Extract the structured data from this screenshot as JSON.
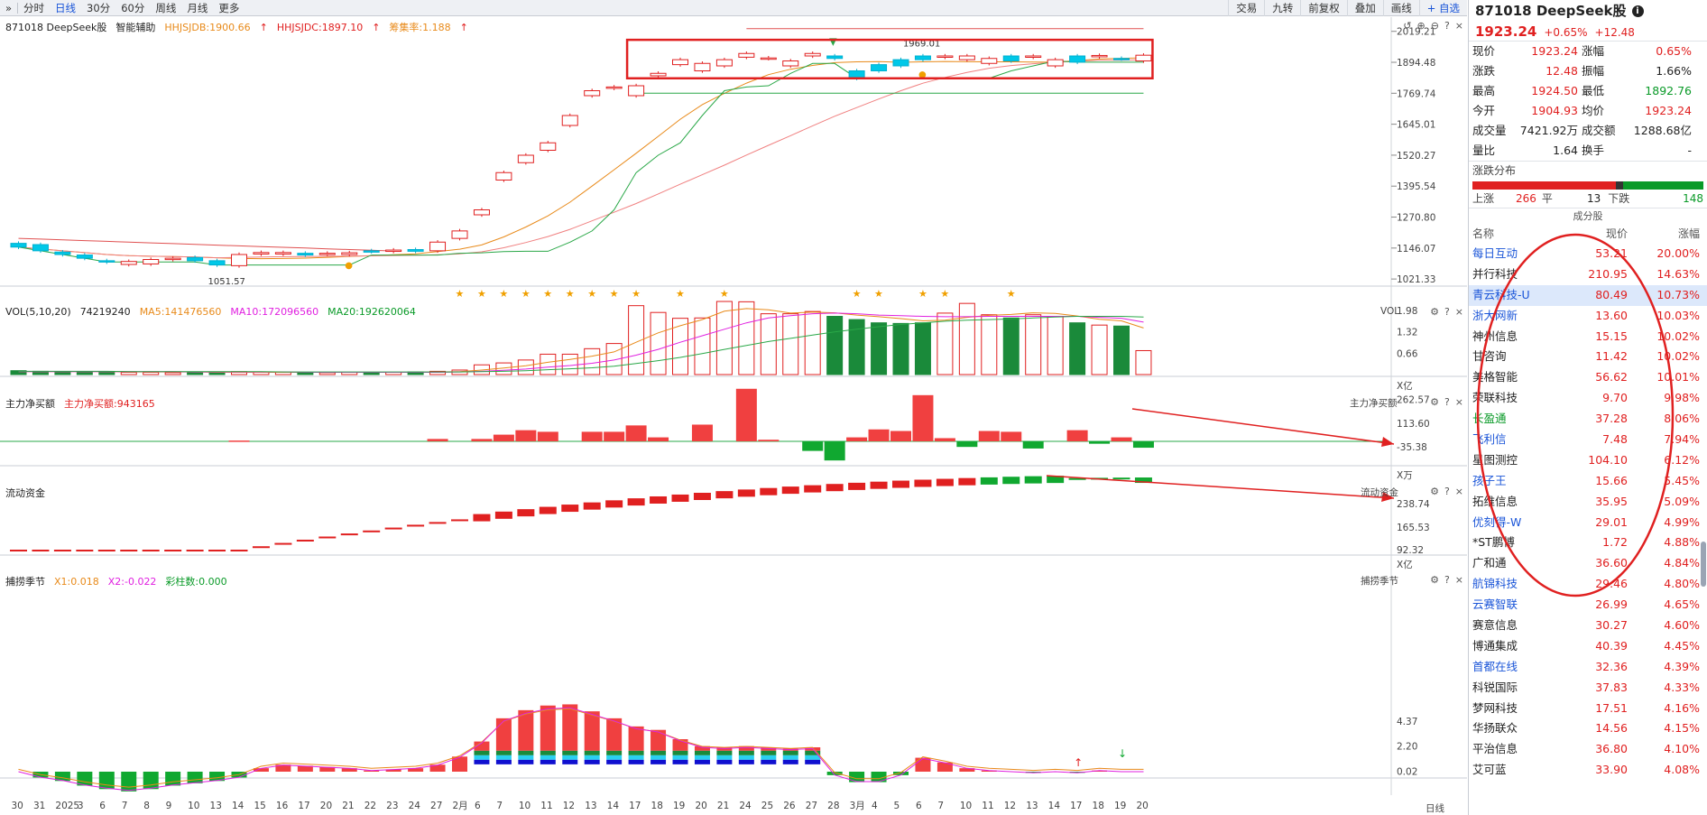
{
  "toolbar": {
    "expand_icon": "double-chevron-right",
    "periods": [
      "分时",
      "日线",
      "30分",
      "60分",
      "周线",
      "月线",
      "更多"
    ],
    "active_period": "日线",
    "right_items": [
      "交易",
      "九转",
      "前复权",
      "叠加",
      "画线",
      "自选"
    ],
    "add_label": "+ 自选"
  },
  "main": {
    "legend": {
      "code_name": "871018 DeepSeek股",
      "assist": "智能辅助",
      "hhjsjdb": "HHJSJDB:1900.66",
      "hhjsjdc": "HHJSJDC:1897.10",
      "ratio": "筹集率:1.188"
    },
    "y_labels": [
      "2019.21",
      "1894.48",
      "1769.74",
      "1645.01",
      "1520.27",
      "1395.54",
      "1270.80",
      "1146.07",
      "1021.33"
    ],
    "high_label": "1969.01",
    "low_label": "1051.57"
  },
  "vol": {
    "legend": {
      "name": "VOL(5,10,20)",
      "v": "74219240",
      "ma5": "MA5:141476560",
      "ma10": "MA10:172096560",
      "ma20": "MA20:192620064"
    },
    "panel_name": "VOL",
    "y_labels": [
      "1.98",
      "1.32",
      "0.66"
    ],
    "unit": "X亿"
  },
  "fund": {
    "legend": {
      "name": "主力净买额",
      "value": "主力净买额:943165"
    },
    "panel_name": "主力净买额",
    "y_labels": [
      "262.57",
      "113.60",
      "-35.38"
    ],
    "unit": "X万"
  },
  "flow": {
    "legend": {
      "name": "流动资金"
    },
    "panel_name": "流动资金",
    "y_labels": [
      "238.74",
      "165.53",
      "92.32"
    ],
    "unit": "X亿"
  },
  "season": {
    "legend": {
      "name": "捕捞季节",
      "x1": "X1:0.018",
      "x2": "X2:-0.022",
      "bars": "彩柱数:0.000"
    },
    "panel_name": "捕捞季节",
    "y_labels": [
      "4.37",
      "2.20",
      "0.02"
    ]
  },
  "x_axis": {
    "labels": [
      "30",
      "31",
      "2025",
      "3",
      "6",
      "7",
      "8",
      "9",
      "10",
      "13",
      "14",
      "15",
      "16",
      "17",
      "20",
      "21",
      "22",
      "23",
      "24",
      "27",
      "2月",
      "6",
      "7",
      "10",
      "11",
      "12",
      "13",
      "14",
      "17",
      "18",
      "19",
      "20",
      "21",
      "24",
      "25",
      "26",
      "27",
      "28",
      "3月",
      "4",
      "5",
      "6",
      "7",
      "10",
      "11",
      "12",
      "13",
      "14",
      "17",
      "18",
      "19",
      "20"
    ],
    "period_tag": "日线"
  },
  "chart_data": {
    "type": "candlestick",
    "dates": [
      "12-30",
      "12-31",
      "01-02",
      "01-03",
      "01-06",
      "01-07",
      "01-08",
      "01-09",
      "01-10",
      "01-13",
      "01-14",
      "01-15",
      "01-16",
      "01-17",
      "01-20",
      "01-21",
      "01-22",
      "01-23",
      "01-24",
      "01-27",
      "02-05",
      "02-06",
      "02-07",
      "02-10",
      "02-11",
      "02-12",
      "02-13",
      "02-14",
      "02-17",
      "02-18",
      "02-19",
      "02-20",
      "02-21",
      "02-24",
      "02-25",
      "02-26",
      "02-27",
      "02-28",
      "03-03",
      "03-04",
      "03-05",
      "03-06",
      "03-07",
      "03-10",
      "03-11",
      "03-12",
      "03-13",
      "03-14",
      "03-17",
      "03-18",
      "03-19",
      "03-20"
    ],
    "open": [
      1165,
      1160,
      1130,
      1118,
      1095,
      1080,
      1082,
      1100,
      1108,
      1095,
      1075,
      1122,
      1122,
      1125,
      1122,
      1120,
      1135,
      1133,
      1140,
      1135,
      1185,
      1280,
      1420,
      1490,
      1540,
      1640,
      1760,
      1790,
      1760,
      1840,
      1885,
      1860,
      1880,
      1915,
      1910,
      1880,
      1920,
      1920,
      1860,
      1885,
      1905,
      1920,
      1915,
      1905,
      1890,
      1920,
      1915,
      1880,
      1920,
      1917,
      1910,
      1900
    ],
    "close": [
      1150,
      1135,
      1120,
      1105,
      1090,
      1092,
      1100,
      1105,
      1095,
      1078,
      1120,
      1128,
      1128,
      1118,
      1125,
      1127,
      1132,
      1138,
      1133,
      1170,
      1215,
      1300,
      1450,
      1520,
      1570,
      1680,
      1780,
      1795,
      1800,
      1850,
      1905,
      1890,
      1905,
      1930,
      1912,
      1900,
      1930,
      1910,
      1830,
      1860,
      1880,
      1905,
      1920,
      1920,
      1910,
      1900,
      1920,
      1905,
      1895,
      1922,
      1908,
      1923
    ],
    "vol_yi": [
      0.12,
      0.1,
      0.08,
      0.09,
      0.08,
      0.07,
      0.07,
      0.06,
      0.08,
      0.06,
      0.09,
      0.07,
      0.07,
      0.06,
      0.06,
      0.07,
      0.07,
      0.07,
      0.08,
      0.1,
      0.14,
      0.3,
      0.36,
      0.45,
      0.63,
      0.63,
      0.8,
      0.96,
      2.13,
      1.92,
      1.74,
      1.75,
      2.26,
      2.25,
      1.88,
      1.88,
      1.95,
      1.8,
      1.7,
      1.6,
      1.58,
      1.6,
      1.9,
      2.2,
      1.85,
      1.75,
      1.85,
      1.8,
      1.6,
      1.53,
      1.5,
      0.74
    ],
    "ma5_yi": [
      0.09,
      0.09,
      0.09,
      0.09,
      0.09,
      0.08,
      0.08,
      0.08,
      0.08,
      0.07,
      0.07,
      0.07,
      0.07,
      0.07,
      0.07,
      0.07,
      0.07,
      0.07,
      0.07,
      0.08,
      0.09,
      0.14,
      0.2,
      0.27,
      0.38,
      0.47,
      0.57,
      0.7,
      1.0,
      1.29,
      1.51,
      1.7,
      1.96,
      2.04,
      2.0,
      1.9,
      1.93,
      1.91,
      1.84,
      1.79,
      1.73,
      1.66,
      1.68,
      1.77,
      1.83,
      1.86,
      1.91,
      1.89,
      1.81,
      1.71,
      1.66,
      1.44
    ],
    "ma10_yi": [
      0.09,
      0.09,
      0.09,
      0.09,
      0.09,
      0.09,
      0.09,
      0.09,
      0.08,
      0.08,
      0.08,
      0.08,
      0.08,
      0.07,
      0.07,
      0.07,
      0.07,
      0.07,
      0.07,
      0.07,
      0.08,
      0.1,
      0.13,
      0.17,
      0.23,
      0.28,
      0.35,
      0.45,
      0.6,
      0.78,
      1.0,
      1.2,
      1.4,
      1.6,
      1.75,
      1.82,
      1.88,
      1.9,
      1.88,
      1.84,
      1.82,
      1.8,
      1.79,
      1.79,
      1.8,
      1.8,
      1.8,
      1.8,
      1.8,
      1.77,
      1.74,
      1.62
    ],
    "ma20_yi": [
      0.1,
      0.1,
      0.1,
      0.1,
      0.1,
      0.09,
      0.09,
      0.09,
      0.09,
      0.09,
      0.09,
      0.09,
      0.08,
      0.08,
      0.08,
      0.08,
      0.08,
      0.08,
      0.08,
      0.08,
      0.08,
      0.09,
      0.1,
      0.12,
      0.15,
      0.18,
      0.21,
      0.26,
      0.34,
      0.43,
      0.53,
      0.65,
      0.78,
      0.9,
      1.02,
      1.12,
      1.22,
      1.32,
      1.4,
      1.48,
      1.55,
      1.6,
      1.65,
      1.68,
      1.7,
      1.72,
      1.75,
      1.78,
      1.8,
      1.8,
      1.8,
      1.78
    ],
    "mainforce_wan": [
      0,
      0,
      0,
      0,
      0,
      0,
      0,
      0,
      0,
      0,
      5,
      0,
      0,
      0,
      0,
      0,
      0,
      0,
      0,
      15,
      0,
      15,
      42,
      70,
      60,
      0,
      60,
      60,
      100,
      25,
      0,
      105,
      0,
      330,
      10,
      0,
      -60,
      -120,
      25,
      75,
      65,
      290,
      20,
      -35,
      65,
      60,
      -45,
      0,
      70,
      -15,
      25,
      -40,
      45
    ]
  }
}
